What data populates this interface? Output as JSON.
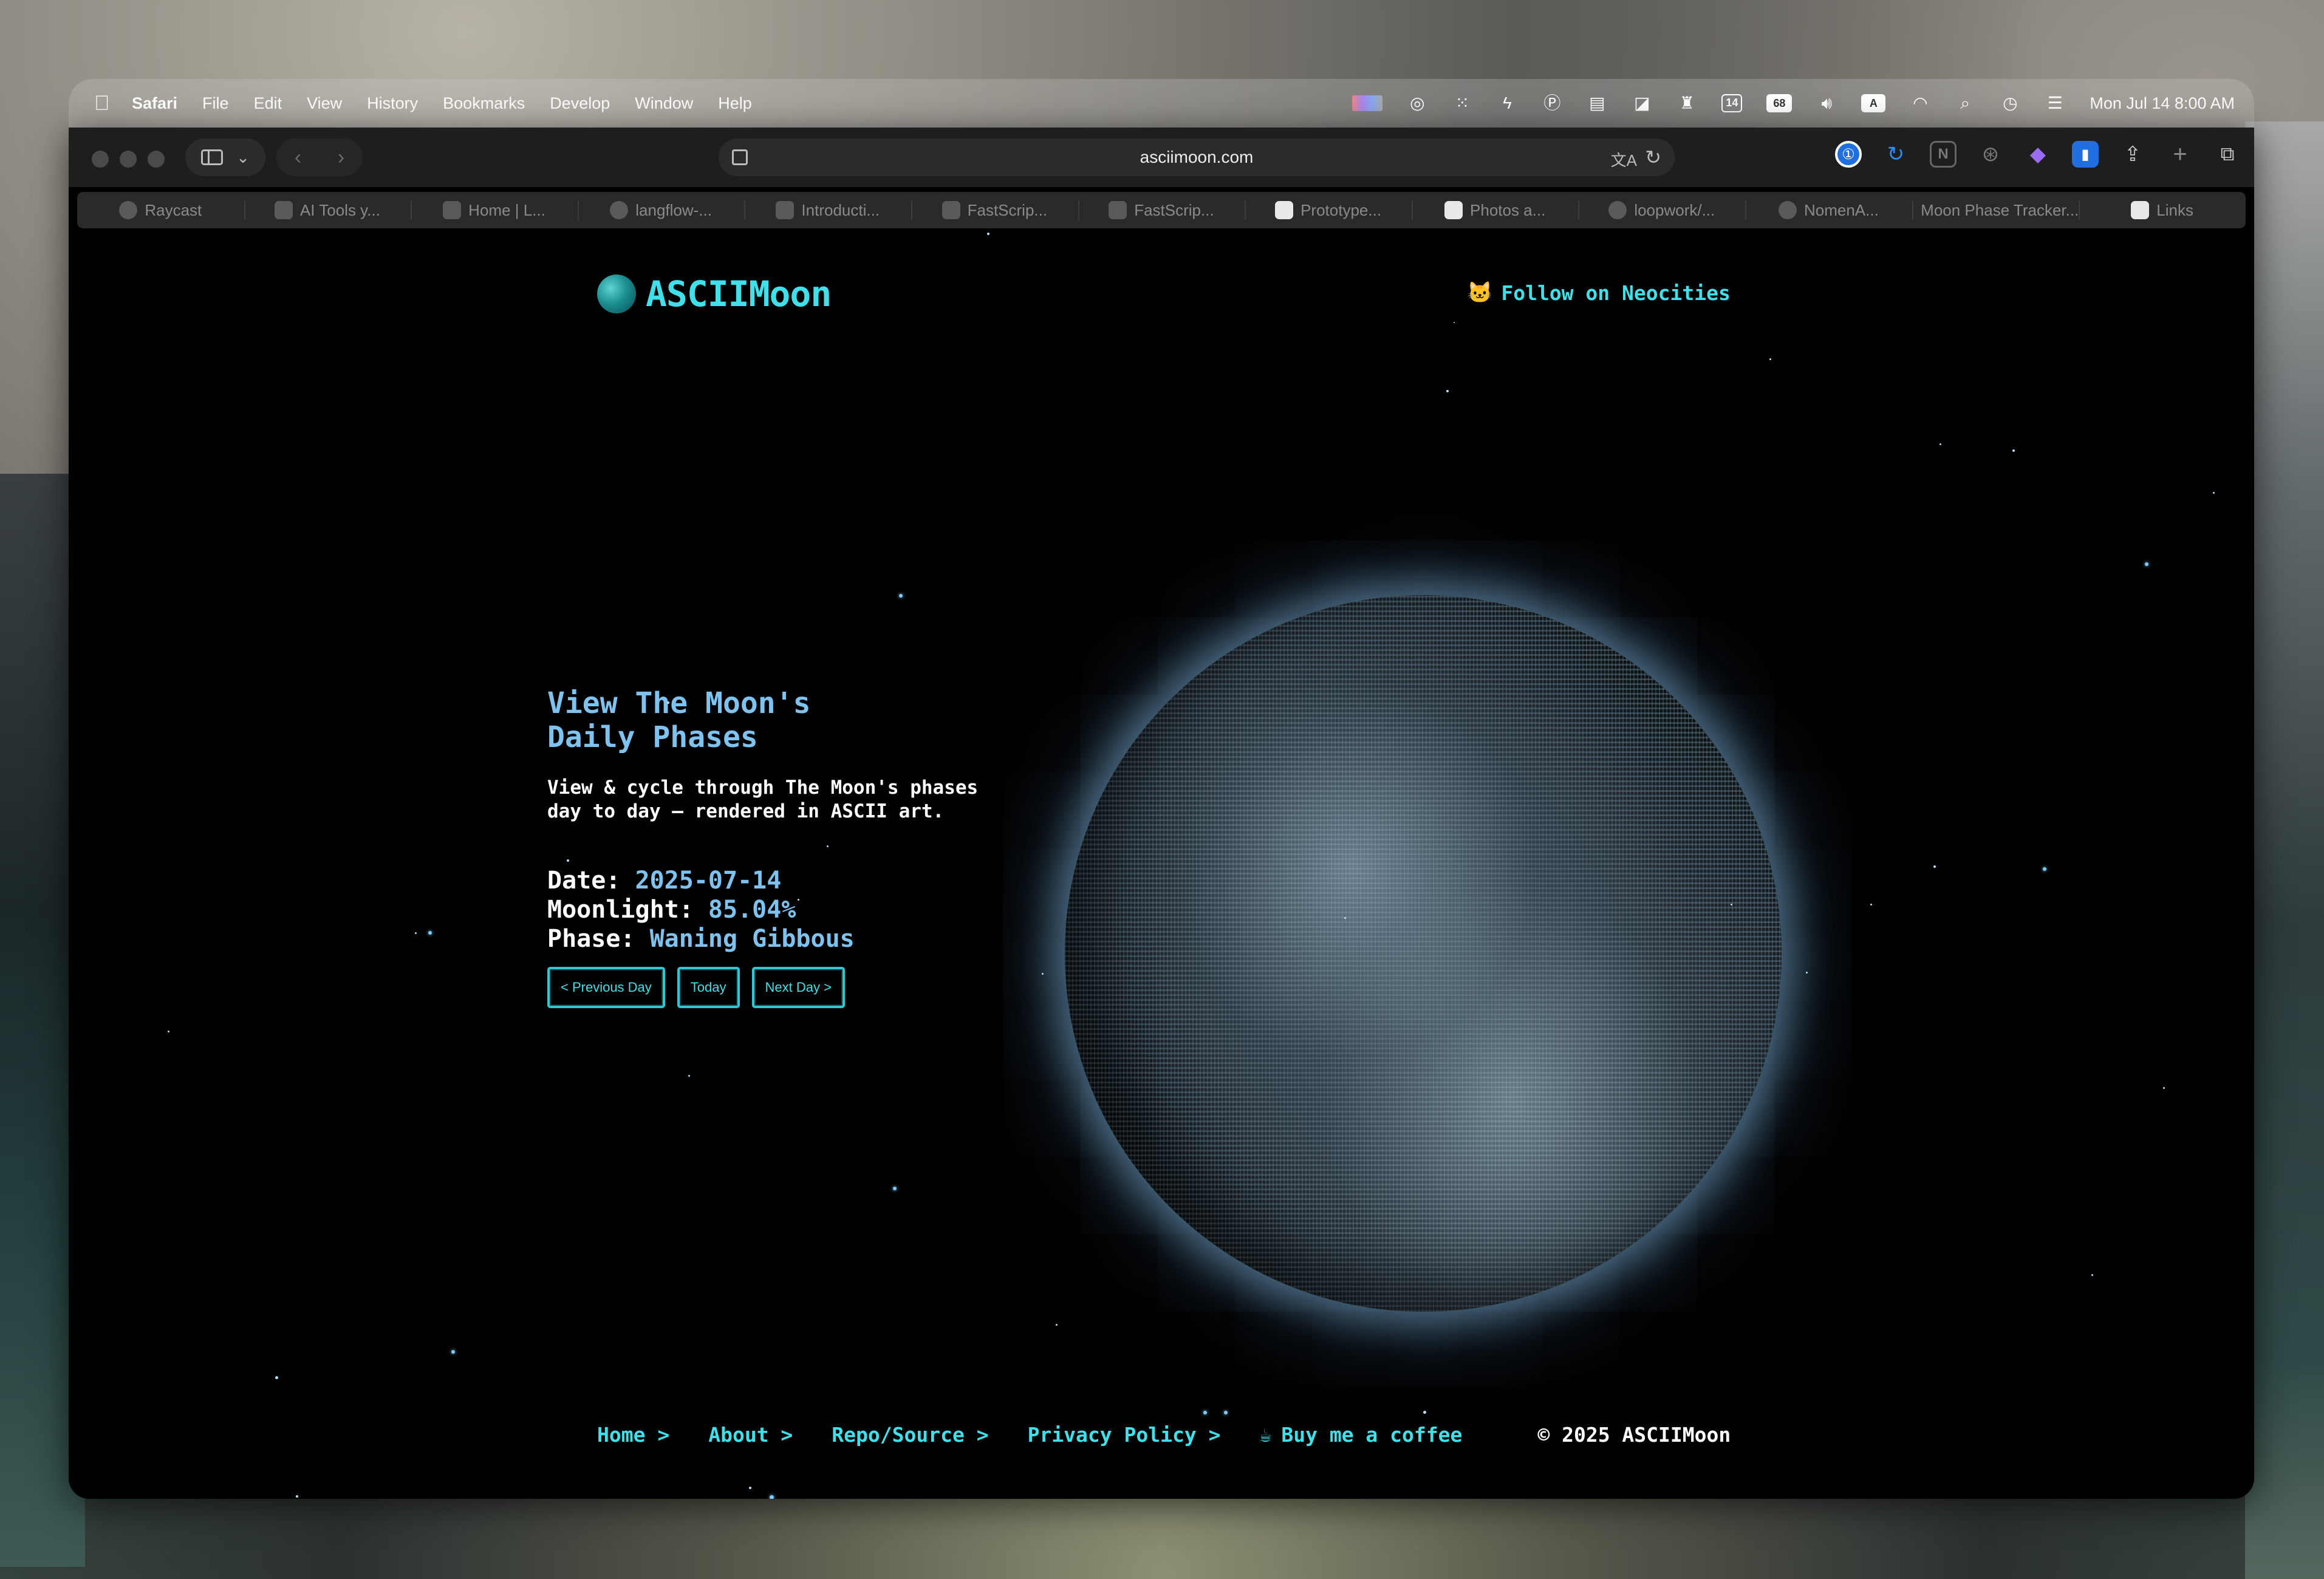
{
  "menubar": {
    "app_name": "Safari",
    "items": [
      "File",
      "Edit",
      "View",
      "History",
      "Bookmarks",
      "Develop",
      "Window",
      "Help"
    ],
    "calendar_day": "14",
    "battery": "68",
    "input_source": "A",
    "clock": "Mon Jul 14  8:00 AM"
  },
  "browser": {
    "url": "asciimoon.com",
    "tabs": [
      {
        "label": "Raycast",
        "icon": "github-icon"
      },
      {
        "label": "AI Tools y...",
        "icon": "youtube-icon"
      },
      {
        "label": "Home | L...",
        "icon": "site-icon"
      },
      {
        "label": "langflow-...",
        "icon": "github-icon"
      },
      {
        "label": "Introducti...",
        "icon": "tools-icon"
      },
      {
        "label": "FastScrip...",
        "icon": "site-icon"
      },
      {
        "label": "FastScrip...",
        "icon": "site-icon"
      },
      {
        "label": "Prototype...",
        "icon": "ai-icon"
      },
      {
        "label": "Photos a...",
        "icon": "photo-icon"
      },
      {
        "label": "loopwork/...",
        "icon": "github-icon"
      },
      {
        "label": "NomenA...",
        "icon": "github-icon"
      },
      {
        "label": "Moon Phase Tracker...",
        "icon": "moon-icon"
      },
      {
        "label": "Links",
        "icon": "link-icon"
      }
    ]
  },
  "site": {
    "logo_text": "ASCIIMoon",
    "follow_label": "Follow on Neocities",
    "headline_line1": "View The Moon's",
    "headline_line2": "Daily Phases",
    "description": "View & cycle through The Moon's phases day to day – rendered in ASCII art.",
    "date_label": "Date:",
    "date_value": "2025-07-14",
    "moonlight_label": "Moonlight:",
    "moonlight_value": "85.04%",
    "phase_label": "Phase:",
    "phase_value": "Waning Gibbous",
    "buttons": {
      "previous": "< Previous Day",
      "today": "Today",
      "next": "Next Day >"
    },
    "footer": {
      "home": "Home >",
      "about": "About >",
      "repo": "Repo/Source >",
      "privacy": "Privacy Policy >",
      "coffee": "Buy me a coffee",
      "copyright": "© 2025 ASCIIMoon"
    },
    "colors": {
      "accent": "#3fe0ea",
      "headline": "#7ec3f0",
      "background": "#000000"
    }
  }
}
